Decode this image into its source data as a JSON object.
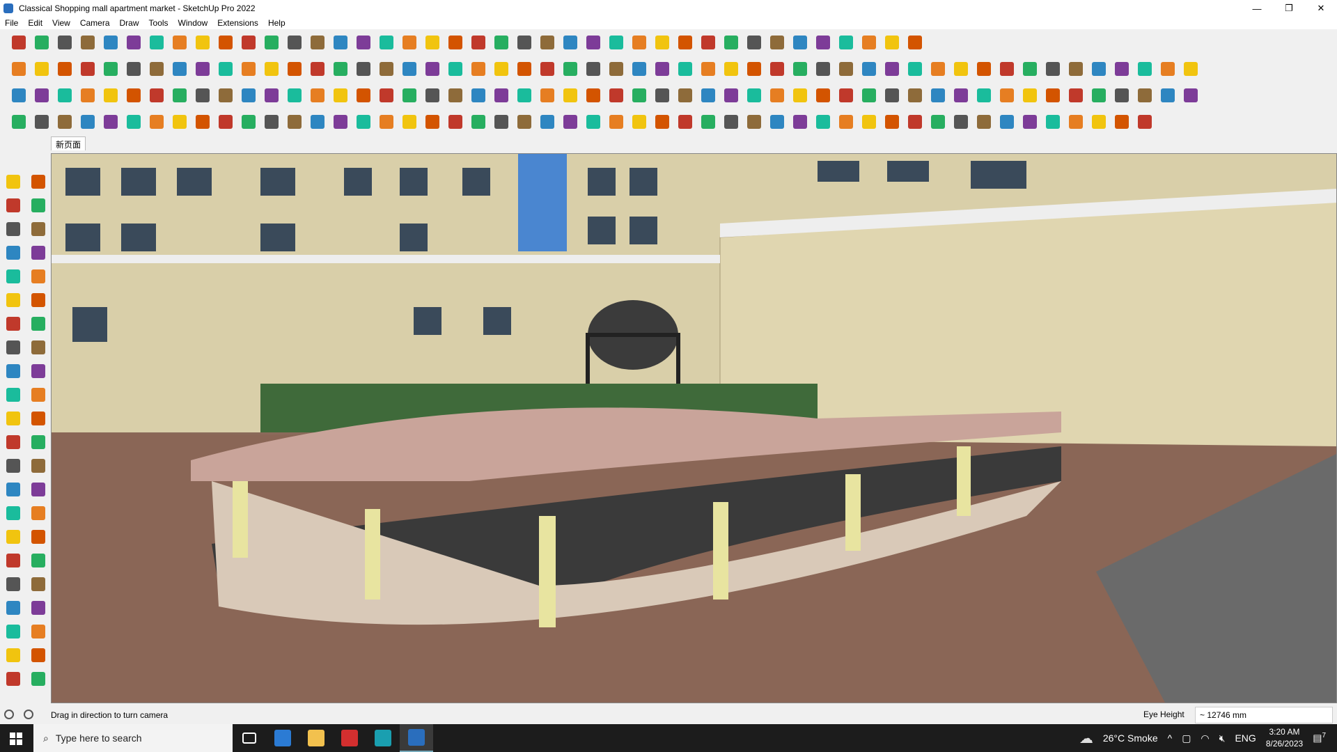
{
  "window": {
    "title": "Classical Shopping mall apartment market - SketchUp Pro 2022",
    "controls": [
      "—",
      "❐",
      "✕"
    ]
  },
  "menu": [
    "File",
    "Edit",
    "View",
    "Camera",
    "Draw",
    "Tools",
    "Window",
    "Extensions",
    "Help"
  ],
  "scene_tab": "新页面",
  "toolbar_colors": [
    "#c0392b",
    "#e67e22",
    "#2e86c1",
    "#27ae60",
    "#f1c40f",
    "#7d3c98",
    "#555555",
    "#d35400",
    "#1abc9c",
    "#8e6b3a"
  ],
  "status": {
    "message": "Drag in direction to turn camera",
    "measure_label": "Eye Height",
    "measure_value": "~ 12746 mm"
  },
  "taskbar": {
    "search_placeholder": "Type here to search",
    "weather": "26°C  Smoke",
    "language": "ENG",
    "time": "3:20 AM",
    "date": "8/26/2023",
    "notifications": "7"
  }
}
